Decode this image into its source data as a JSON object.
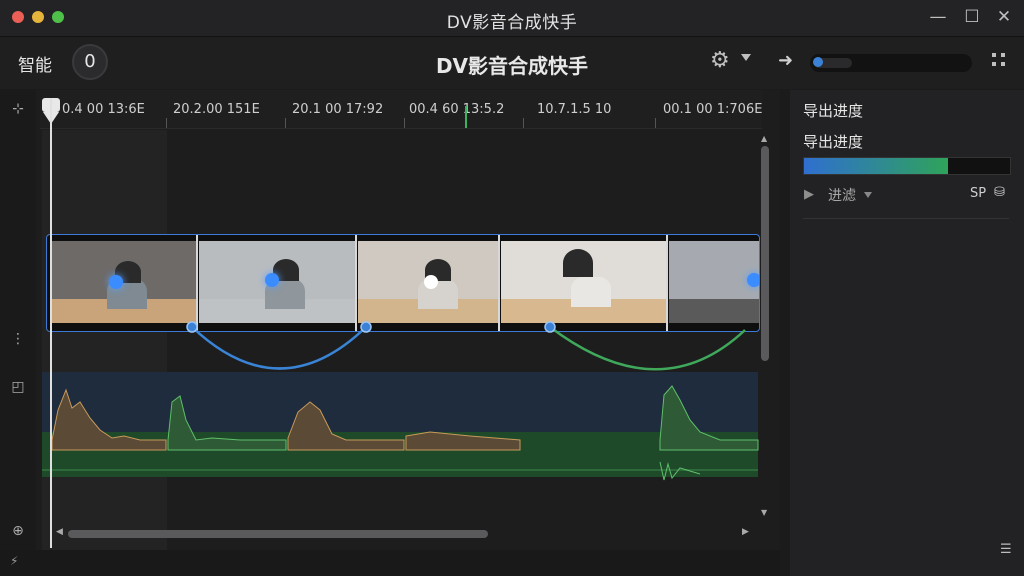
{
  "window": {
    "title": "DV影音合成快手"
  },
  "toolbar": {
    "brand": "智能",
    "counter": "0",
    "title": "DV影音合成快手"
  },
  "ruler": {
    "ticks": [
      "0.4 00  13:6E",
      "20.2.00  151E",
      "20.1 00  17:92",
      "00.4 60  13:5.2",
      "10.7.1.5   10",
      "00.1 00  1:706E"
    ]
  },
  "panel": {
    "header": "导出进度",
    "progress_label": "导出进度",
    "progress_fraction": 0.7,
    "filter_label": "进滤",
    "sp_label": "SP"
  },
  "colors": {
    "accent_blue": "#3b82d6",
    "accent_green": "#3bb25e"
  }
}
